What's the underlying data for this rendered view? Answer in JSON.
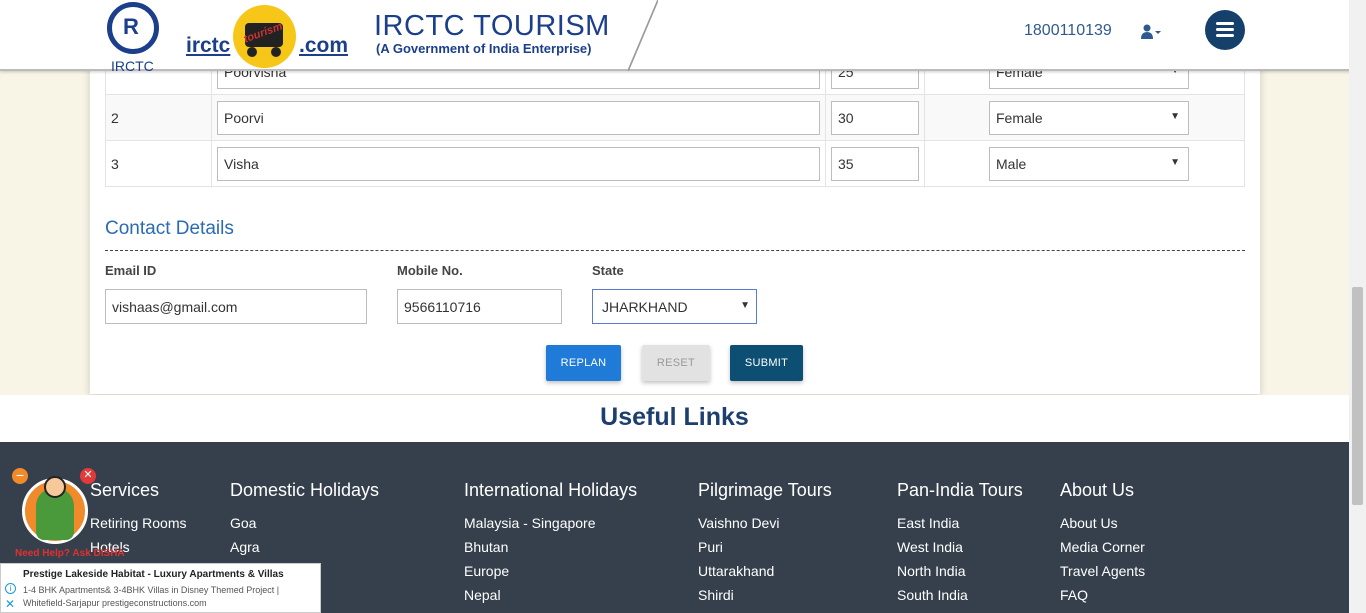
{
  "header": {
    "logo_caption": "IRCTC",
    "logo_text_left": "irctc",
    "logo_text_right": ".com",
    "tourism_badge": "tourism",
    "title": "IRCTC TOURISM",
    "subtitle": "(A Government of India Enterprise)",
    "phone": "1800110139"
  },
  "passengers": [
    {
      "no": "",
      "name": "Poorvisha",
      "age": "25",
      "gender": "Female"
    },
    {
      "no": "2",
      "name": "Poorvi",
      "age": "30",
      "gender": "Female"
    },
    {
      "no": "3",
      "name": "Visha",
      "age": "35",
      "gender": "Male"
    }
  ],
  "contact": {
    "title": "Contact Details",
    "email_label": "Email ID",
    "email_value": "vishaas@gmail.com",
    "mobile_label": "Mobile No.",
    "mobile_value": "9566110716",
    "state_label": "State",
    "state_value": "JHARKHAND"
  },
  "buttons": {
    "replan": "REPLAN",
    "reset": "RESET",
    "submit": "SUBMIT"
  },
  "useful_links": {
    "title": "Useful Links",
    "columns": [
      {
        "heading": "Services",
        "links": [
          "Retiring Rooms",
          "Hotels"
        ]
      },
      {
        "heading": "Domestic Holidays",
        "links": [
          "Goa",
          "Agra"
        ]
      },
      {
        "heading": "International Holidays",
        "links": [
          "Malaysia - Singapore",
          "Bhutan",
          "Europe",
          "Nepal"
        ]
      },
      {
        "heading": "Pilgrimage Tours",
        "links": [
          "Vaishno Devi",
          "Puri",
          "Uttarakhand",
          "Shirdi"
        ]
      },
      {
        "heading": "Pan-India Tours",
        "links": [
          "East India",
          "West India",
          "North India",
          "South India"
        ]
      },
      {
        "heading": "About Us",
        "links": [
          "About Us",
          "Media Corner",
          "Travel Agents",
          "FAQ"
        ]
      }
    ]
  },
  "disha": {
    "caption": "Need Help? Ask DISHA"
  },
  "ad": {
    "headline": "Prestige Lakeside Habitat - Luxury Apartments & Villas",
    "line1": "1-4 BHK Apartments& 3-4BHK Villas in Disney Themed Project |",
    "line2": "Whitefield-Sarjapur prestigeconstructions.com"
  },
  "colors": {
    "brand": "#1b3f8b",
    "replan": "#1f7ad8",
    "submit": "#0d4f72",
    "footer": "#35404c",
    "page_bg": "#f8f4e6"
  }
}
